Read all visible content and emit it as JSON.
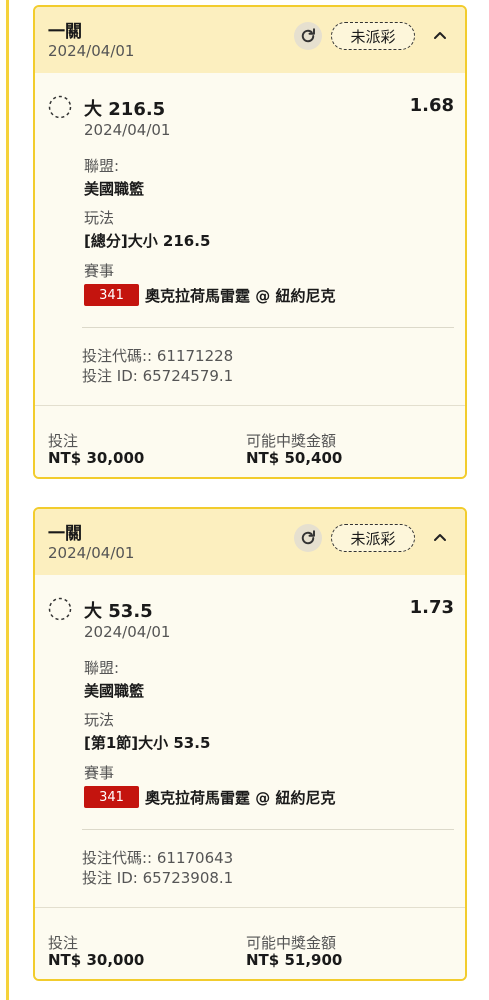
{
  "bets": [
    {
      "header": {
        "title": "一關",
        "date": "2024/04/01",
        "status": "未派彩"
      },
      "selection": {
        "name": "大 216.5",
        "odds": "1.68",
        "date": "2024/04/01"
      },
      "league": {
        "label": "聯盟:",
        "value": "美國職籃"
      },
      "market": {
        "label": "玩法",
        "value": "[總分]大小 216.5"
      },
      "event": {
        "label": "賽事",
        "id": "341",
        "name": "奧克拉荷馬雷霆 @ 紐約尼克"
      },
      "codes": {
        "bet_code": "投注代碼:: 61171228",
        "bet_id": "投注 ID: 65724579.1"
      },
      "footer": {
        "stake_label": "投注",
        "stake_value": "NT$ 30,000",
        "payout_label": "可能中獎金額",
        "payout_value": "NT$ 50,400"
      }
    },
    {
      "header": {
        "title": "一關",
        "date": "2024/04/01",
        "status": "未派彩"
      },
      "selection": {
        "name": "大 53.5",
        "odds": "1.73",
        "date": "2024/04/01"
      },
      "league": {
        "label": "聯盟:",
        "value": "美國職籃"
      },
      "market": {
        "label": "玩法",
        "value": "[第1節]大小 53.5"
      },
      "event": {
        "label": "賽事",
        "id": "341",
        "name": "奧克拉荷馬雷霆 @ 紐約尼克"
      },
      "codes": {
        "bet_code": "投注代碼:: 61170643",
        "bet_id": "投注 ID: 65723908.1"
      },
      "footer": {
        "stake_label": "投注",
        "stake_value": "NT$ 30,000",
        "payout_label": "可能中獎金額",
        "payout_value": "NT$ 51,900"
      }
    }
  ],
  "icons": {
    "refresh": "refresh-icon",
    "collapse": "chevron-up-icon",
    "pending": "pending-circle-icon"
  },
  "colors": {
    "accent_border": "#f2cc2d",
    "header_bg": "#fcefbf",
    "event_badge": "#c4140e"
  }
}
